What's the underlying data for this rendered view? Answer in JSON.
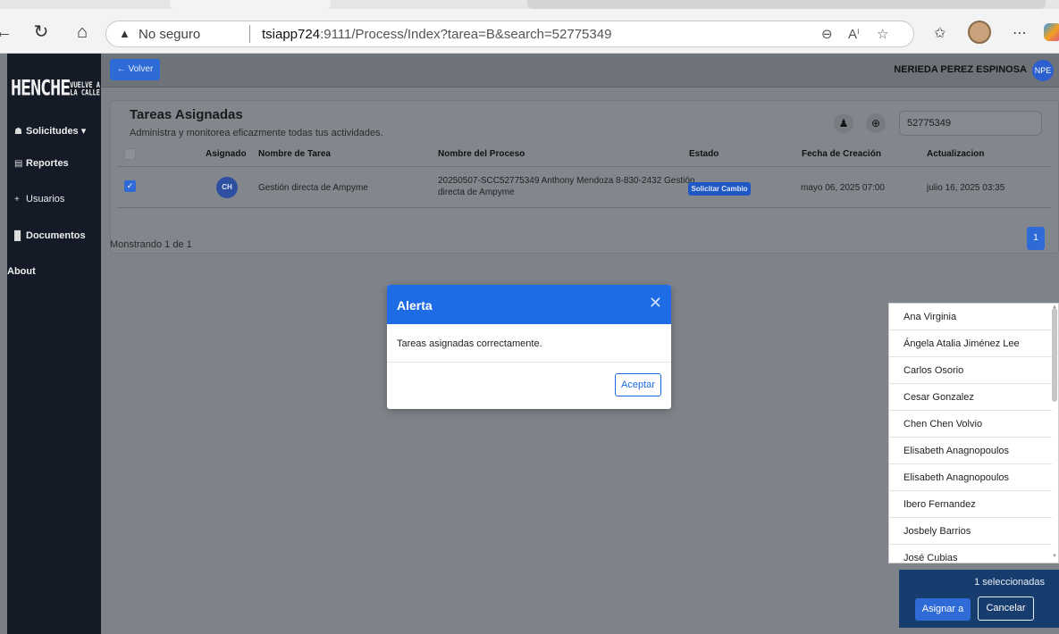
{
  "browser": {
    "security": "No seguro",
    "url_host": "tsiapp724",
    "url_rest": ":9111/Process/Index?tarea=B&search=52775349"
  },
  "sidebar": {
    "logo_main": "HENCHE",
    "logo_small_top": "VUELVE A",
    "logo_small_bottom": "LA CALLE",
    "items": [
      {
        "label": "Solicitudes ▾",
        "icon": "home-icon"
      },
      {
        "label": "Reportes",
        "icon": "chart-icon"
      },
      {
        "label": "Usuarios",
        "icon": "plus-icon"
      },
      {
        "label": "Documentos",
        "icon": "document-icon"
      },
      {
        "label": "About",
        "icon": ""
      }
    ]
  },
  "header": {
    "back_label": "← Volver",
    "user_name": "NERIEDA PEREZ ESPINOSA",
    "user_initials": "NPE"
  },
  "card": {
    "title": "Tareas Asignadas",
    "subtitle": "Administra y monitorea eficazmente todas tus actividades.",
    "search_value": "52775349",
    "columns": [
      "Asignado",
      "Nombre de Tarea",
      "Nombre del Proceso",
      "Estado",
      "Fecha de Creación",
      "Actualizacion"
    ],
    "row": {
      "initials": "CH",
      "task": "Gestión directa de Ampyme",
      "process_line1": "20250507-SCC52775349 Anthony Mendoza 8-830-2432 Gestión",
      "process_line2": "directa de Ampyme",
      "status": "Solicitar Cambio",
      "created": "mayo 06, 2025 07:00",
      "updated": "julio 16, 2025 03:35"
    },
    "footer": "Monstrando 1 de 1",
    "page": "1"
  },
  "modal": {
    "title": "Alerta",
    "close": "✕",
    "message": "Tareas asignadas correctamente.",
    "ok_label": "Aceptar",
    "header_color": "#1e6be6"
  },
  "assignees": [
    "Ana Virginia",
    "Ángela Atalia Jiménez Lee",
    "Carlos Osorio",
    "Cesar Gonzalez",
    "Chen Chen Volvio",
    "Elisabeth Anagnopoulos",
    "Elisabeth Anagnopoulos",
    "Ibero Fernandez",
    "Josbely Barrios",
    "José Cubias"
  ],
  "assign_panel": {
    "count": "1 seleccionadas",
    "assign_label": "Asignar a",
    "cancel_label": "Cancelar"
  },
  "colors": {
    "primary": "#2f6bd6",
    "sidebar": "#141a26",
    "panel": "#173c6e"
  }
}
